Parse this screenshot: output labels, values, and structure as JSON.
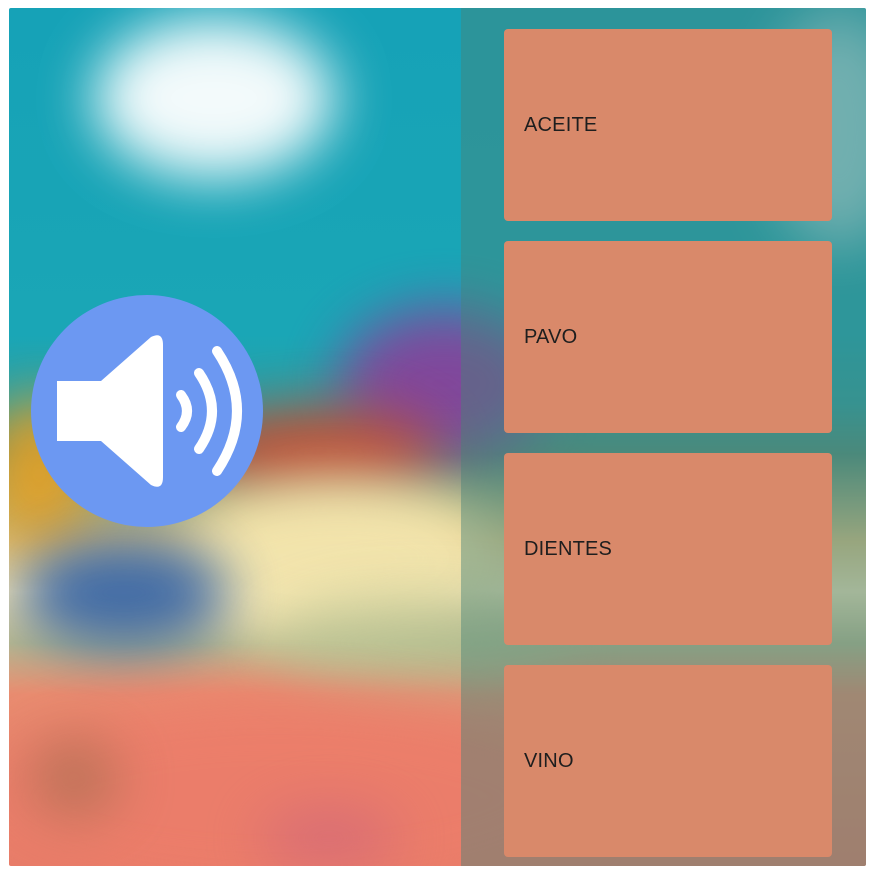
{
  "audio_button": {
    "icon": "speaker-volume-icon",
    "color": "#6c98f2"
  },
  "answer_options": [
    {
      "label": "ACEITE"
    },
    {
      "label": "PAVO"
    },
    {
      "label": "DIENTES"
    },
    {
      "label": "VINO"
    }
  ],
  "colors": {
    "card": "#d9896a",
    "card_text": "#1e1e1e"
  }
}
